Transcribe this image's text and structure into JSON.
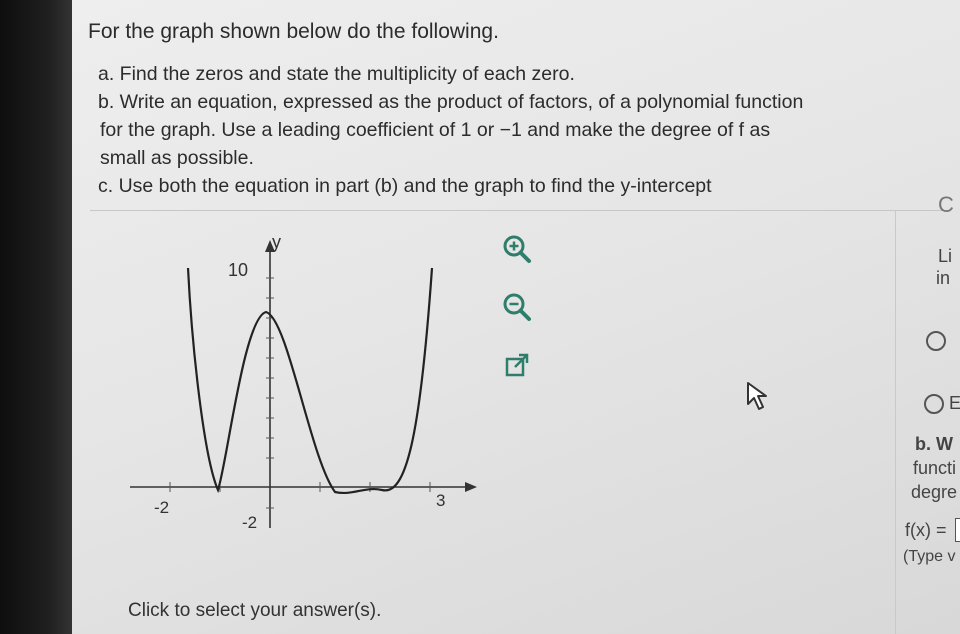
{
  "question": {
    "title": "For the graph shown below do the following.",
    "part_a": "a. Find the zeros and state the multiplicity of each zero.",
    "part_b_line1": "b. Write an equation, expressed as the product of factors, of a polynomial function",
    "part_b_line2": "for the graph. Use a leading coefficient of 1 or −1 and make the degree of f as",
    "part_b_line3": "small as possible.",
    "part_c": "c. Use both the equation in part (b) and the graph to find the y-intercept"
  },
  "graph": {
    "y_axis_label": "y",
    "y_tick_top": "10",
    "y_tick_bottom": "-2",
    "x_tick_left": "-2",
    "x_tick_right": "3"
  },
  "tools": {
    "zoom_in_icon": "zoom-in-icon",
    "zoom_out_icon": "zoom-out-icon",
    "popout_icon": "external-link-icon"
  },
  "footer": {
    "text": "Click to select your answer(s)."
  },
  "right_panel": {
    "list_label1": "Li",
    "list_label2": "in",
    "radio2_text": "E",
    "part_b_label": "b. W",
    "functi_text": "functi",
    "degre_text": "degre",
    "fx_label": "f(x) =",
    "type_hint": "(Type v"
  },
  "colors": {
    "screen_bg": "#e8e8e8",
    "text": "#2c2c2c",
    "icon": "#2f7d6b"
  }
}
